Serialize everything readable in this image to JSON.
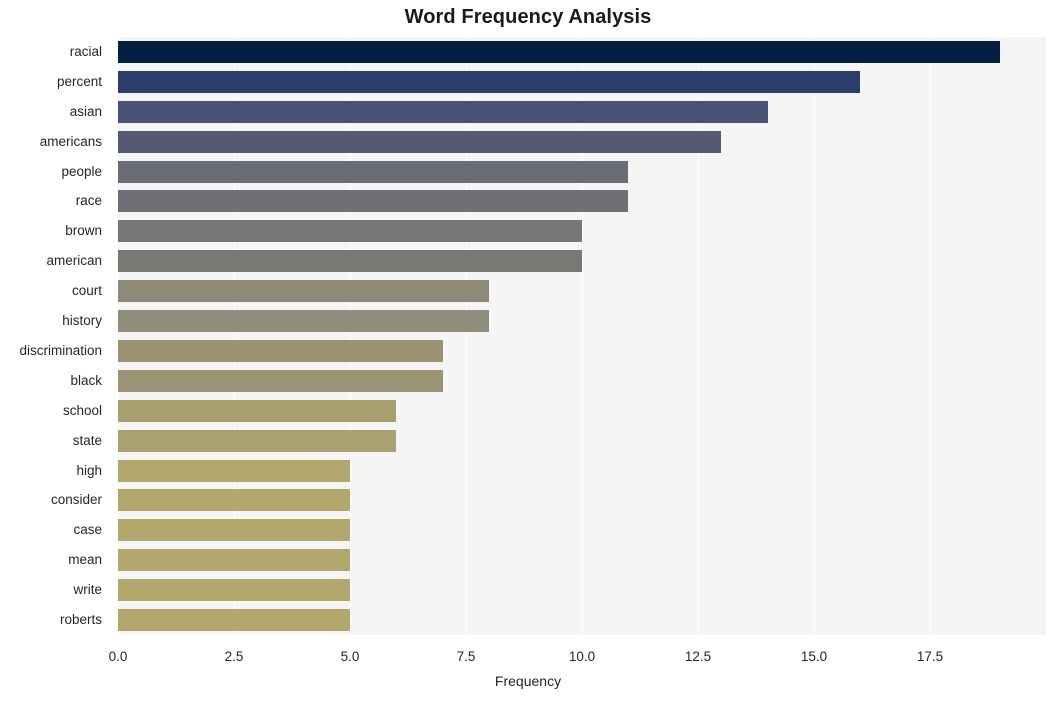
{
  "chart_data": {
    "type": "bar",
    "orientation": "horizontal",
    "title": "Word Frequency Analysis",
    "xlabel": "Frequency",
    "ylabel": "",
    "categories": [
      "racial",
      "percent",
      "asian",
      "americans",
      "people",
      "race",
      "brown",
      "american",
      "court",
      "history",
      "discrimination",
      "black",
      "school",
      "state",
      "high",
      "consider",
      "case",
      "mean",
      "write",
      "roberts"
    ],
    "values": [
      19,
      16,
      14,
      13,
      11,
      11,
      10,
      10,
      8,
      8,
      7,
      7,
      6,
      6,
      5,
      5,
      5,
      5,
      5,
      5
    ],
    "xlim": [
      0,
      20
    ],
    "x_ticks": [
      0.0,
      2.5,
      5.0,
      7.5,
      10.0,
      12.5,
      15.0,
      17.5
    ],
    "x_tick_labels": [
      "0.0",
      "2.5",
      "5.0",
      "7.5",
      "10.0",
      "12.5",
      "15.0",
      "17.5"
    ],
    "grid": true,
    "grid_axis": "x",
    "legend": null,
    "bar_colors": [
      "#041e42",
      "#2a3d6b",
      "#465274",
      "#545a73",
      "#6a6c76",
      "#6f7076",
      "#767676",
      "#787874",
      "#8d8b78",
      "#908e7b",
      "#9a9273",
      "#9b9474",
      "#a89f6e",
      "#aaa170",
      "#b2a86e",
      "#b2a86e",
      "#b2a86e",
      "#b2a86e",
      "#b2a86e",
      "#b2a86e"
    ],
    "plot_background": "#f5f5f5",
    "figure_background": "#ffffff",
    "gridline_color": "#ffffff",
    "text_color": "#262626"
  }
}
